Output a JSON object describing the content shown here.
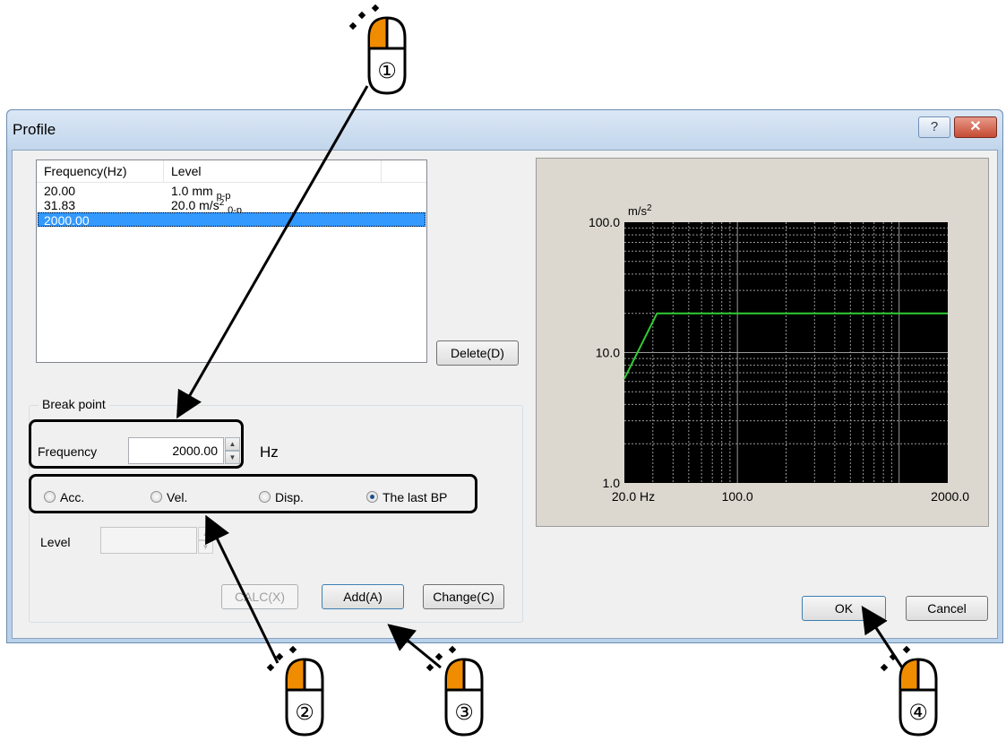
{
  "dialog": {
    "title": "Profile",
    "help_symbol": "?",
    "close_symbol": "✕"
  },
  "listview": {
    "columns": [
      "Frequency(Hz)",
      "Level"
    ],
    "rows": [
      {
        "frequency": "20.00",
        "level": "1.0 mm",
        "level_sub": "p-p",
        "level_sup": ""
      },
      {
        "frequency": "31.83",
        "level": "20.0 m/s",
        "level_sup": "2",
        "level_sub": "0-p"
      },
      {
        "frequency": "2000.00",
        "level": "",
        "level_sup": "",
        "level_sub": "",
        "selected": true
      }
    ]
  },
  "buttons": {
    "delete": "Delete(D)",
    "calc": "CALC(X)",
    "add": "Add(A)",
    "change": "Change(C)",
    "ok": "OK",
    "cancel": "Cancel"
  },
  "breakpoint": {
    "group_title": "Break point",
    "frequency_label": "Frequency",
    "frequency_value": "2000.00",
    "frequency_unit": "Hz",
    "radios": [
      {
        "label": "Acc.",
        "checked": false
      },
      {
        "label": "Vel.",
        "checked": false
      },
      {
        "label": "Disp.",
        "checked": false
      },
      {
        "label": "The last BP",
        "checked": true
      }
    ],
    "level_label": "Level",
    "level_value": ""
  },
  "chart_data": {
    "type": "line",
    "x_scale": "log",
    "y_scale": "log",
    "xlim": [
      20,
      2000
    ],
    "ylim": [
      1,
      100
    ],
    "x_tick_labels": [
      "20.0 Hz",
      "100.0",
      "2000.0"
    ],
    "x_tick_values": [
      20,
      100,
      2000
    ],
    "y_tick_labels": [
      "100.0",
      "10.0",
      "1.0"
    ],
    "y_tick_values": [
      100,
      10,
      1
    ],
    "y_unit": "m/s",
    "y_unit_sup": "2",
    "grid": true,
    "background": "#000000",
    "series": [
      {
        "color": "#33cc33",
        "x": [
          20,
          31.83,
          2000
        ],
        "y": [
          6.3,
          20,
          20
        ]
      }
    ]
  },
  "annotations": {
    "markers": [
      "①",
      "②",
      "③",
      "④"
    ],
    "mouse_color": "#f08c00"
  }
}
